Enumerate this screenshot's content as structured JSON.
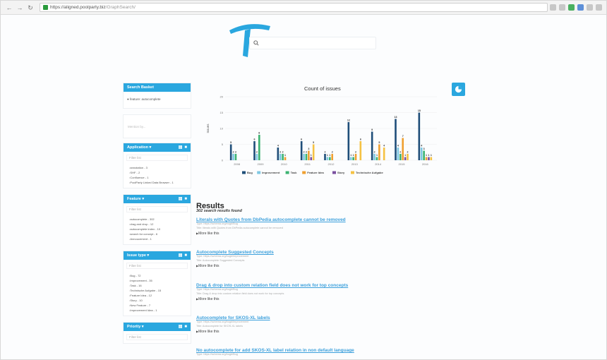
{
  "browser": {
    "url_host": "https://aligned.poolparty.biz",
    "url_path": "/GraphSearch/"
  },
  "search": {
    "value": "",
    "placeholder": ""
  },
  "sidebar": {
    "search_basket": {
      "title": "Search Basket",
      "items": [
        "feature: autocomplete"
      ]
    },
    "mentions_placeholder": "Mention by...",
    "facets": [
      {
        "title": "Application",
        "filter_placeholder": "Filter list",
        "items": [
          "annotation - 3",
          "SHF - 2",
          "Confluence - 1",
          "PoolParty Linked Data Browser - 1"
        ]
      },
      {
        "title": "Feature",
        "filter_placeholder": "Filter list",
        "items": [
          "autocomplete - 302",
          "drag and drop - 12",
          "autocomplete index - 10",
          "search for concept - 6",
          "Annoucement - 1"
        ]
      },
      {
        "title": "Issue type",
        "filter_placeholder": "Filter list",
        "items": [
          "Bug - 72",
          "Improvement - 35",
          "Task - 16",
          "Technische Aufgabe - 15",
          "Feature Idea - 12",
          "Story - 10",
          "New Feature - 7",
          "Improvement Idea - 1"
        ]
      },
      {
        "title": "Priority",
        "filter_placeholder": "Filter list",
        "items": []
      }
    ]
  },
  "chart_data": {
    "type": "bar",
    "title": "Count of issues",
    "xlabel": "",
    "ylabel": "Issues",
    "ylim": [
      0,
      20
    ],
    "yticks": [
      0,
      5,
      10,
      15,
      20
    ],
    "grid": true,
    "legend": "bottom",
    "categories": [
      "2009",
      "2010",
      "2011",
      "2012",
      "2013",
      "2014",
      "2015",
      "2016"
    ],
    "series": [
      {
        "name": "Bug",
        "color": "#1f4e79",
        "values": [
          5,
          6,
          4,
          6,
          2,
          12,
          9,
          13,
          15
        ]
      },
      {
        "name": "Improvement",
        "color": "#7ec8e3",
        "values": [
          2,
          2,
          2,
          2,
          1,
          1,
          2,
          4,
          4
        ]
      },
      {
        "name": "Task",
        "color": "#3cb371",
        "values": [
          2,
          8,
          2,
          2,
          1,
          1,
          1,
          2,
          3
        ]
      },
      {
        "name": "Feature Idea",
        "color": "#f0a030",
        "values": [
          0,
          0,
          1,
          3,
          2,
          2,
          5,
          7,
          1
        ]
      },
      {
        "name": "Story",
        "color": "#7a4fa0",
        "values": [
          0,
          0,
          0,
          1,
          0,
          0,
          0,
          1,
          1
        ]
      },
      {
        "name": "Technische Aufgabe",
        "color": "#f5c243",
        "values": [
          0,
          0,
          0,
          5,
          0,
          6,
          4,
          2,
          1
        ]
      }
    ],
    "bar_groups": [
      "2008",
      "2009",
      "2010",
      "2011",
      "2012",
      "2013",
      "2014",
      "2015",
      "2016"
    ],
    "data_labels": true
  },
  "results": {
    "title": "Results",
    "count": "302 search results found",
    "more_label": "More like this",
    "items": [
      {
        "title": "Literals with Quotes from DbPedia autocomplete cannot be removed",
        "type_line": "Type: https://schema.org/bug#/Bug",
        "desc_line": "Title: literals with Quotes from DbPedia autocomplete cannot be removed"
      },
      {
        "title": "Autocomplete Suggested Concepts",
        "type_line": "Type: https://schema.org/bug#/Improvement",
        "desc_line": "Title: Autocomplete Suggested Concepts"
      },
      {
        "title": "Drag & drop into custom relation field does not work for top concepts",
        "type_line": "Type: https://schema.org/bug#/Bug",
        "desc_line": "Title: Drag & drop into custom relation field does not work for top concepts"
      },
      {
        "title": "Autocomplete for SKOS-XL labels",
        "type_line": "Type: https://schema.org/bug#/Improvement",
        "desc_line": "Title: Autocomplete for SKOS-XL labels"
      },
      {
        "title": "No autocomplete for add SKOS-XL label relation in non default language",
        "type_line": "Type: https://schema.org/bug#/Bug",
        "desc_line": "Title: No autocomplete for add SKOS-XL label relation in non default language"
      }
    ]
  }
}
